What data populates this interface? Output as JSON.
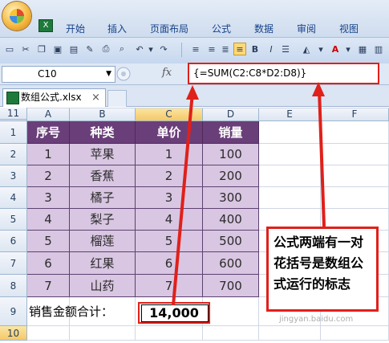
{
  "ribbon": {
    "tabs": [
      "开始",
      "插入",
      "页面布局",
      "公式",
      "数据",
      "审阅",
      "视图"
    ]
  },
  "toolbar": {
    "icons": [
      "new-icon",
      "cut-icon",
      "copy-icon",
      "save-icon",
      "print-preview-icon",
      "format-painter-icon",
      "print-icon",
      "search-icon",
      "undo-icon",
      "redo-icon",
      "align-left-icon",
      "align-center-icon",
      "align-right-icon",
      "bold-icon",
      "italic-icon",
      "fill-color-icon",
      "font-color-icon",
      "borders-icon",
      "merge-icon"
    ]
  },
  "formula_bar": {
    "name_box": "C10",
    "fx": "fx",
    "formula": "{=SUM(C2:C8*D2:D8)}"
  },
  "document_tab": {
    "name": "数组公式.xlsx",
    "close": "×"
  },
  "sheet": {
    "selected_cell": "C10",
    "columns": [
      "A",
      "B",
      "C",
      "D",
      "E",
      "F"
    ],
    "rows": [
      "1",
      "2",
      "3",
      "4",
      "5",
      "6",
      "7",
      "8",
      "9",
      "10",
      "11"
    ],
    "headers": [
      "序号",
      "种类",
      "单价",
      "销量"
    ],
    "data": [
      [
        "1",
        "苹果",
        "1",
        "100"
      ],
      [
        "2",
        "香蕉",
        "2",
        "200"
      ],
      [
        "3",
        "橘子",
        "3",
        "300"
      ],
      [
        "4",
        "梨子",
        "4",
        "400"
      ],
      [
        "5",
        "榴莲",
        "5",
        "500"
      ],
      [
        "6",
        "红果",
        "6",
        "600"
      ],
      [
        "7",
        "山药",
        "7",
        "700"
      ]
    ],
    "total_label": "销售金额合计：",
    "total_value": "14,000"
  },
  "callout": {
    "text": "公式两端有一对花括号是数组公式运行的标志",
    "color": "#e0201a"
  },
  "watermark": "jingyan.baidu.com"
}
